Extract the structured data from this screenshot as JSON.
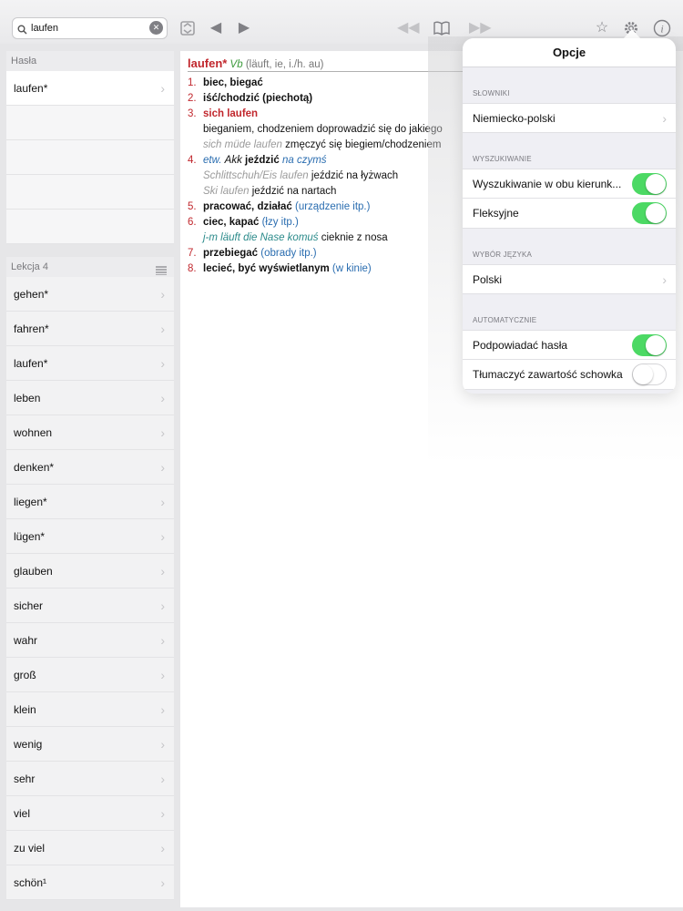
{
  "search": {
    "value": "laufen"
  },
  "toolbar": {
    "icons": [
      "search-icon",
      "clear-icon",
      "sync-icon",
      "back-icon",
      "forward-icon",
      "rewind-icon",
      "book-icon",
      "fast-forward-icon",
      "star-icon",
      "gear-icon",
      "info-icon"
    ]
  },
  "hasla": {
    "header": "Hasła",
    "items": [
      "laufen*"
    ]
  },
  "lekcja": {
    "header": "Lekcja 4",
    "items": [
      "gehen*",
      "fahren*",
      "laufen*",
      "leben",
      "wohnen",
      "denken*",
      "liegen*",
      "lügen*",
      "glauben",
      "sicher",
      "wahr",
      "groß",
      "klein",
      "wenig",
      "sehr",
      "viel",
      "zu viel",
      "schön¹"
    ]
  },
  "entry": {
    "headword": "laufen*",
    "pos": "Vb",
    "forms": "(läuft, ie, i./h. au)",
    "s1": {
      "num": "1.",
      "text": "biec, biegać"
    },
    "s2": {
      "num": "2.",
      "text": "iść/chodzić (piechotą)"
    },
    "s3": {
      "num": "3.",
      "text": "sich laufen",
      "def": "bieganiem, chodzeniem doprowadzić się do jakiego",
      "ex_de": "sich müde laufen",
      "ex_pl": "zmęczyć się biegiem/chodzeniem"
    },
    "s4": {
      "num": "4.",
      "pre": "etw.",
      "akk": "Akk",
      "text": "jeździć",
      "obj": "na czymś",
      "ex1_de": "Schlittschuh/Eis laufen",
      "ex1_pl": "jeździć na łyżwach",
      "ex2_de": "Ski laufen",
      "ex2_pl": "jeździć na nartach"
    },
    "s5": {
      "num": "5.",
      "text": "pracować, działać",
      "note": "(urządzenie itp.)"
    },
    "s6": {
      "num": "6.",
      "text": "ciec, kapać",
      "note": "(łzy itp.)",
      "ex_de": "j-m läuft die Nase komuś",
      "ex_pl": "cieknie z nosa"
    },
    "s7": {
      "num": "7.",
      "text": "przebiegać",
      "note": "(obrady itp.)"
    },
    "s8": {
      "num": "8.",
      "text": "lecieć, być wyświetlanym",
      "note": "(w kinie)"
    }
  },
  "options": {
    "title": "Opcje",
    "slowniki": {
      "header": "SŁOWNIKI",
      "dictionary": "Niemiecko-polski"
    },
    "wyszukiwanie": {
      "header": "WYSZUKIWANIE",
      "both_directions": "Wyszukiwanie w obu kierunk...",
      "both_directions_on": true,
      "inflection": "Fleksyjne",
      "inflection_on": true
    },
    "jezyk": {
      "header": "WYBÓR JĘZYKA",
      "language": "Polski"
    },
    "auto": {
      "header": "AUTOMATYCZNIE",
      "suggest": "Podpowiadać hasła",
      "suggest_on": true,
      "clipboard": "Tłumaczyć zawartość schowka",
      "clipboard_on": false
    }
  },
  "colors": {
    "accent_red": "#c1272d",
    "link_blue": "#2a6db0",
    "toggle_green": "#4cd964"
  }
}
